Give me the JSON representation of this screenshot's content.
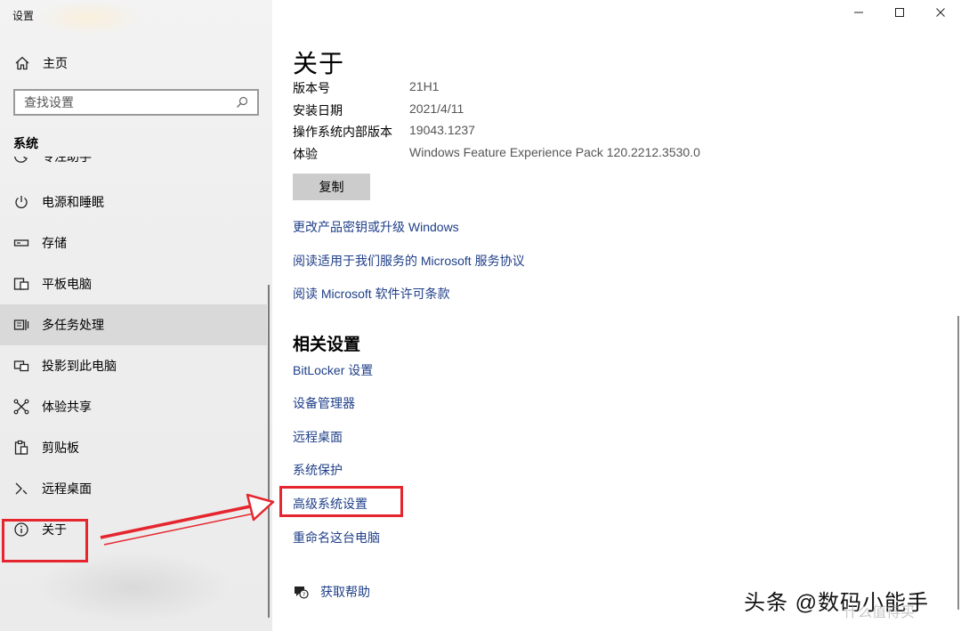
{
  "window": {
    "title": "设置",
    "controls": {
      "minimize": "minimize-icon",
      "maximize": "maximize-icon",
      "close": "close-icon"
    }
  },
  "sidebar": {
    "home_label": "主页",
    "search_placeholder": "查找设置",
    "section_label": "系统",
    "items": [
      {
        "label": "专注助手",
        "icon": "focus-assist-icon"
      },
      {
        "label": "电源和睡眠",
        "icon": "power-icon"
      },
      {
        "label": "存储",
        "icon": "storage-icon"
      },
      {
        "label": "平板电脑",
        "icon": "tablet-icon"
      },
      {
        "label": "多任务处理",
        "icon": "multitasking-icon"
      },
      {
        "label": "投影到此电脑",
        "icon": "project-icon"
      },
      {
        "label": "体验共享",
        "icon": "shared-experiences-icon"
      },
      {
        "label": "剪贴板",
        "icon": "clipboard-icon"
      },
      {
        "label": "远程桌面",
        "icon": "remote-desktop-icon"
      },
      {
        "label": "关于",
        "icon": "info-icon"
      }
    ]
  },
  "main": {
    "title": "关于",
    "specs": [
      {
        "key": "版本号",
        "value": "21H1"
      },
      {
        "key": "安装日期",
        "value": "2021/4/11"
      },
      {
        "key": "操作系统内部版本",
        "value": "19043.1237"
      },
      {
        "key": "体验",
        "value": "Windows Feature Experience Pack 120.2212.3530.0"
      }
    ],
    "copy_label": "复制",
    "links": [
      "更改产品密钥或升级 Windows",
      "阅读适用于我们服务的 Microsoft 服务协议",
      "阅读 Microsoft 软件许可条款"
    ],
    "related_title": "相关设置",
    "related_links": [
      "BitLocker 设置",
      "设备管理器",
      "远程桌面",
      "系统保护",
      "高级系统设置",
      "重命名这台电脑"
    ],
    "help_label": "获取帮助"
  },
  "annotation": {
    "highlight_color": "#e6262e",
    "watermark": "头条 @数码小能手",
    "watermark_faint": "什么值得买"
  }
}
